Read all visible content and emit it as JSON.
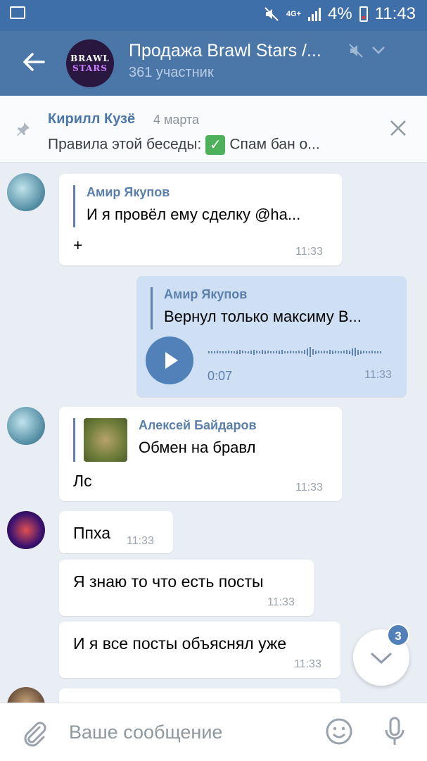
{
  "status_bar": {
    "network_label": "4G+",
    "battery_percent": "4%",
    "time": "11:43",
    "icons": [
      "image-icon",
      "mute-icon",
      "signal-icon",
      "battery-icon"
    ]
  },
  "header": {
    "chat_title": "Продажа Brawl Stars /...",
    "members": "361 участник",
    "avatar_line1": "BRAWL",
    "avatar_line2": "STARS",
    "icons": [
      "back-arrow-icon",
      "mute-icon",
      "chevron-down-icon"
    ]
  },
  "pinned": {
    "author": "Кирилл Кузё",
    "date": "4 марта",
    "text_before": "Правила этой беседы:",
    "text_after": "Спам бан о...",
    "icons": [
      "pin-icon",
      "checkmark-emoji-icon",
      "close-icon"
    ]
  },
  "messages": [
    {
      "fwd_author": "Амир Якупов",
      "fwd_text": "И я провёл ему сделку @ha...",
      "text": "+",
      "time": "11:33"
    },
    {
      "fwd_author": "Амир Якупов",
      "fwd_text": "Вернул только максиму В...",
      "audio_duration": "0:07",
      "time": "11:33"
    },
    {
      "fwd_author": "Алексей Байдаров",
      "fwd_text": "Обмен на бравл",
      "text": "Лс",
      "time": "11:33"
    },
    {
      "text": "Ппха",
      "time": "11:33"
    },
    {
      "text": "Я знаю то что есть посты",
      "time": "11:33"
    },
    {
      "text": "И я все посты объяснял уже",
      "time": "11:33"
    }
  ],
  "scroll_down": {
    "badge": "3"
  },
  "composer": {
    "placeholder": "Ваше сообщение"
  },
  "colors": {
    "header": "#4a76a8",
    "status_bar": "#3f6fa9",
    "outgoing_bubble": "#cfe0f5",
    "accent": "#5181b8",
    "background": "#e9eef4"
  }
}
